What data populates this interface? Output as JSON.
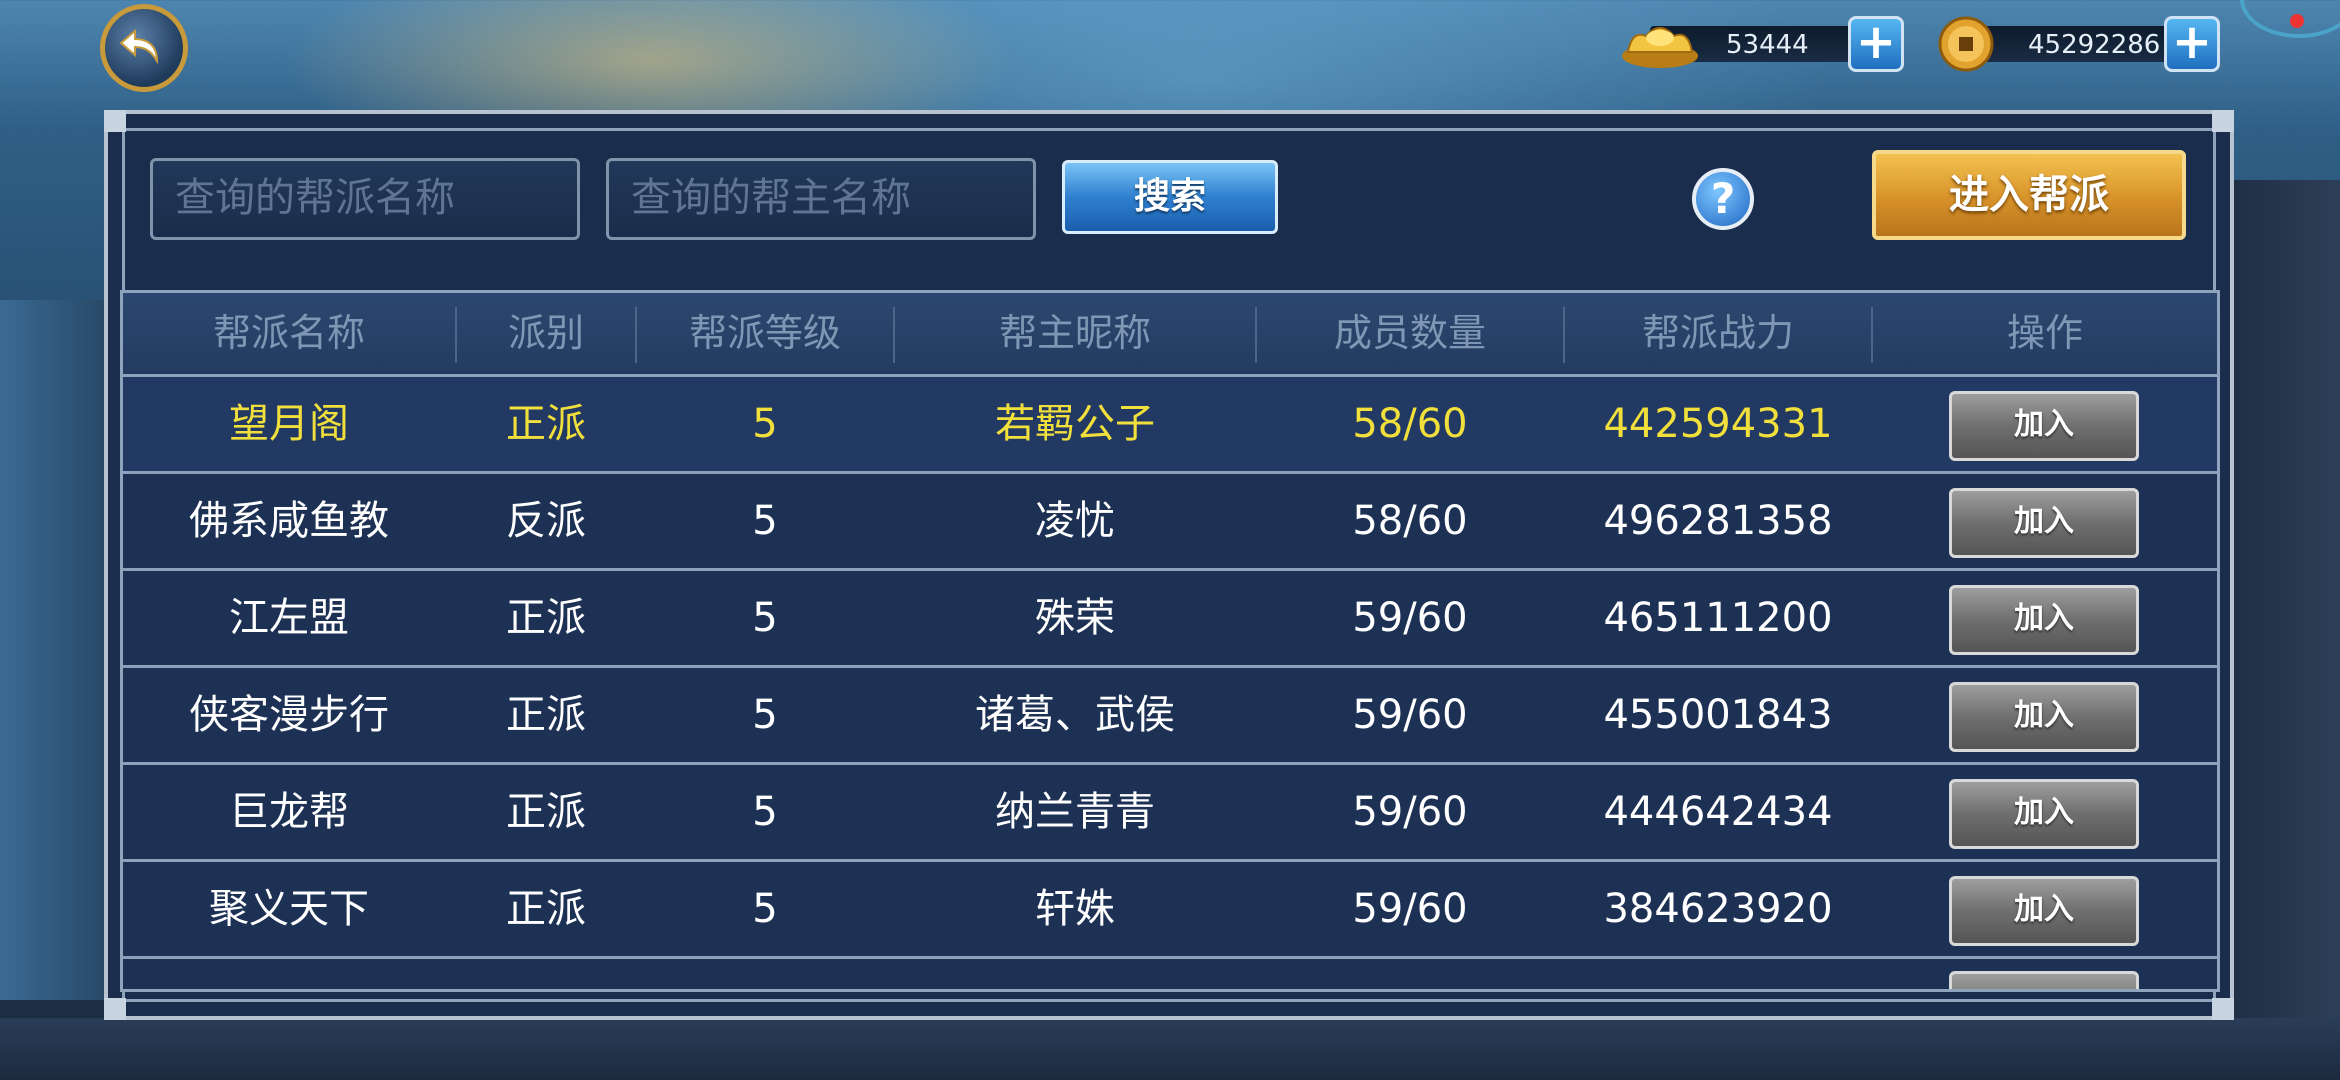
{
  "currency": {
    "gold_value": "53444",
    "coin_value": "45292286"
  },
  "search": {
    "guild_placeholder": "查询的帮派名称",
    "leader_placeholder": "查询的帮主名称",
    "search_label": "搜索",
    "help_label": "?",
    "enter_label": "进入帮派"
  },
  "table": {
    "headers": [
      "帮派名称",
      "派别",
      "帮派等级",
      "帮主昵称",
      "成员数量",
      "帮派战力",
      "操作"
    ],
    "join_label": "加入",
    "rows": [
      {
        "name": "望月阁",
        "faction": "正派",
        "level": "5",
        "leader": "若羁公子",
        "members": "58/60",
        "power": "442594331"
      },
      {
        "name": "佛系咸鱼教",
        "faction": "反派",
        "level": "5",
        "leader": "凌忧",
        "members": "58/60",
        "power": "496281358"
      },
      {
        "name": "江左盟",
        "faction": "正派",
        "level": "5",
        "leader": "殊荣",
        "members": "59/60",
        "power": "465111200"
      },
      {
        "name": "侠客漫步行",
        "faction": "正派",
        "level": "5",
        "leader": "诸葛、武侯",
        "members": "59/60",
        "power": "455001843"
      },
      {
        "name": "巨龙帮",
        "faction": "正派",
        "level": "5",
        "leader": "纳兰青青",
        "members": "59/60",
        "power": "444642434"
      },
      {
        "name": "聚义天下",
        "faction": "正派",
        "level": "5",
        "leader": "轩姝",
        "members": "59/60",
        "power": "384623920"
      }
    ]
  },
  "colors": {
    "highlight_row_text": "#f1df3b",
    "panel_bg": "#1a2d4c",
    "enter_button": "#d7922a",
    "search_button": "#2f80cf"
  },
  "icons": [
    "back-arrow-icon",
    "gold-ingot-icon",
    "copper-coin-icon",
    "plus-icon",
    "help-icon"
  ]
}
